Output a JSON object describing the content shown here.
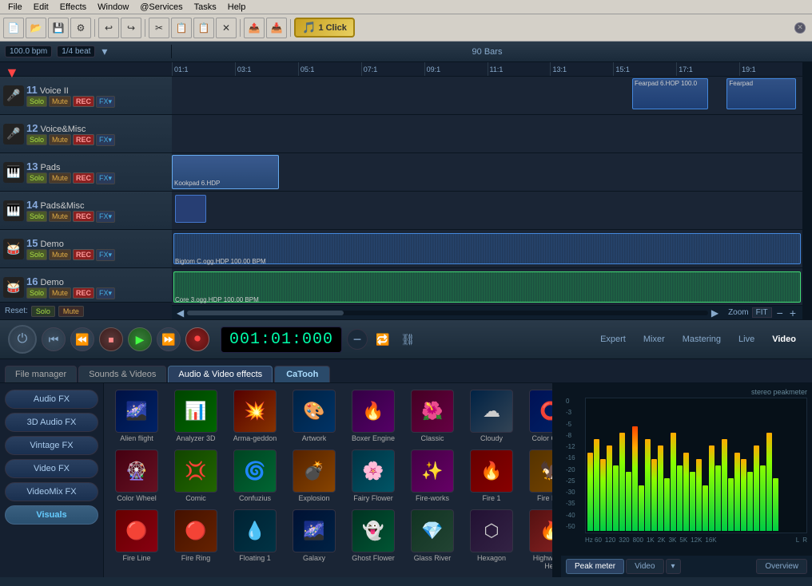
{
  "menu": {
    "items": [
      "File",
      "Edit",
      "Effects",
      "Window",
      "@Services",
      "Tasks",
      "Help"
    ]
  },
  "toolbar": {
    "buttons": [
      "📄",
      "📂",
      "💾",
      "🔧",
      "↩",
      "↪",
      "✂",
      "📋",
      "📋",
      "❌",
      "📤",
      "📥",
      "🎵"
    ]
  },
  "bpm": {
    "value": "100.0 bpm",
    "beat": "1/4 beat"
  },
  "timeline": {
    "title": "90 Bars",
    "markers": [
      "01:1",
      "03:1",
      "05:1",
      "07:1",
      "09:1",
      "11:1",
      "13:1",
      "15:1",
      "17:1",
      "19:1"
    ]
  },
  "tracks": [
    {
      "number": "11",
      "name": "Voice II",
      "icon": "🎤"
    },
    {
      "number": "12",
      "name": "Voice&Misc",
      "icon": "🎤"
    },
    {
      "number": "13",
      "name": "Pads",
      "icon": "🎹"
    },
    {
      "number": "14",
      "name": "Pads&Misc",
      "icon": "🎹"
    },
    {
      "number": "15",
      "name": "Demo",
      "icon": "🥁"
    },
    {
      "number": "16",
      "name": "Demo",
      "icon": "🥁"
    }
  ],
  "track_blocks": {
    "track11": [
      {
        "label": "Fearpad 6.HOP 100.0",
        "left": "74%",
        "width": "12%",
        "color": "blue"
      },
      {
        "label": "Fearpad",
        "left": "89%",
        "width": "10%",
        "color": "blue"
      }
    ],
    "track13": [
      {
        "label": "Kookpad 6.HDP",
        "left": "0%",
        "width": "18%",
        "color": "blue"
      }
    ],
    "track15": [
      {
        "label": "Bigtom C.ogg.HDP 100.00 BPM",
        "left": "0%",
        "width": "100%",
        "color": "blue"
      }
    ],
    "track16": [
      {
        "label": "Core 3.ogg.HDP 100.00 BPM",
        "left": "0%",
        "width": "100%",
        "color": "green"
      }
    ]
  },
  "transport": {
    "time": "001:01:000",
    "buttons": [
      "⏮",
      "⏭",
      "⏹",
      "▶",
      "⏩",
      "⏺"
    ]
  },
  "mode_buttons": {
    "items": [
      "Expert",
      "Mixer",
      "Mastering",
      "Live",
      "Video"
    ],
    "active": "Video"
  },
  "bottom_tabs": {
    "items": [
      "File manager",
      "Sounds & Videos",
      "Audio & Video effects",
      "CaTooh"
    ],
    "active": "Audio & Video effects"
  },
  "effects_sidebar": {
    "buttons": [
      "Audio FX",
      "3D Audio FX",
      "Vintage FX",
      "Video FX",
      "VideoMix FX",
      "Visuals"
    ],
    "active": "Visuals"
  },
  "effects": [
    {
      "name": "Alien flight",
      "emoji": "🌌",
      "color": "#001833"
    },
    {
      "name": "Analyzer 3D",
      "emoji": "📊",
      "color": "#002200"
    },
    {
      "name": "Arma-geddon",
      "emoji": "💥",
      "color": "#220000"
    },
    {
      "name": "Artwork",
      "emoji": "🎨",
      "color": "#001122"
    },
    {
      "name": "Boxer Engine",
      "emoji": "🔥",
      "color": "#110022"
    },
    {
      "name": "Classic",
      "emoji": "🌺",
      "color": "#220011"
    },
    {
      "name": "Cloudy",
      "emoji": "☁",
      "color": "#112233"
    },
    {
      "name": "Color Circle",
      "emoji": "🔵",
      "color": "#001133"
    },
    {
      "name": "Color Wheel",
      "emoji": "🎡",
      "color": "#221100"
    },
    {
      "name": "Comic",
      "emoji": "💢",
      "color": "#112200"
    },
    {
      "name": "Confuzius",
      "emoji": "🌀",
      "color": "#002211"
    },
    {
      "name": "Explosion",
      "emoji": "💣",
      "color": "#221100"
    },
    {
      "name": "Fairy Flower",
      "emoji": "🌸",
      "color": "#002233"
    },
    {
      "name": "Fire-works",
      "emoji": "✨",
      "color": "#220022"
    },
    {
      "name": "Fire 1",
      "emoji": "🔥",
      "color": "#330000"
    },
    {
      "name": "Fire Bird",
      "emoji": "🦅",
      "color": "#221100"
    },
    {
      "name": "Fire Line",
      "emoji": "🔴",
      "color": "#330000"
    },
    {
      "name": "Fire Ring",
      "emoji": "🔴",
      "color": "#221100"
    },
    {
      "name": "Floating 1",
      "emoji": "💧",
      "color": "#002233"
    },
    {
      "name": "Galaxy",
      "emoji": "🌌",
      "color": "#001122"
    },
    {
      "name": "Ghost Flower",
      "emoji": "👻",
      "color": "#002211"
    },
    {
      "name": "Glass River",
      "emoji": "💎",
      "color": "#113322"
    },
    {
      "name": "Hexagon",
      "emoji": "⬡",
      "color": "#221133"
    },
    {
      "name": "Highway to Hell",
      "emoji": "🔥",
      "color": "#330011"
    }
  ],
  "peakmeter": {
    "title": "stereo peakmeter",
    "db_labels": [
      "0",
      "-3",
      "-5",
      "-8",
      "-12",
      "-16",
      "-20",
      "-25",
      "-30",
      "-35",
      "-40",
      "-50"
    ],
    "freq_labels": [
      "Hz 60",
      "120",
      "320",
      "800",
      "1K",
      "2K",
      "3K",
      "5K",
      "12K",
      "16K",
      "L",
      "R"
    ],
    "bars": [
      60,
      70,
      55,
      65,
      50,
      75,
      45,
      80,
      35,
      70,
      55,
      65,
      40,
      75,
      50,
      60,
      45,
      55,
      35,
      65,
      50,
      70,
      40,
      60,
      55,
      45,
      65,
      50,
      75,
      40
    ]
  },
  "meter_tabs": {
    "items": [
      "Peak meter",
      "Video",
      "Overview"
    ],
    "active": "Peak meter"
  },
  "zoom": {
    "label": "Zoom",
    "fit_label": "FIT"
  },
  "reset": {
    "label": "Reset:"
  },
  "catooh_tab": "CaTooh",
  "oneclick_label": "1 Click"
}
